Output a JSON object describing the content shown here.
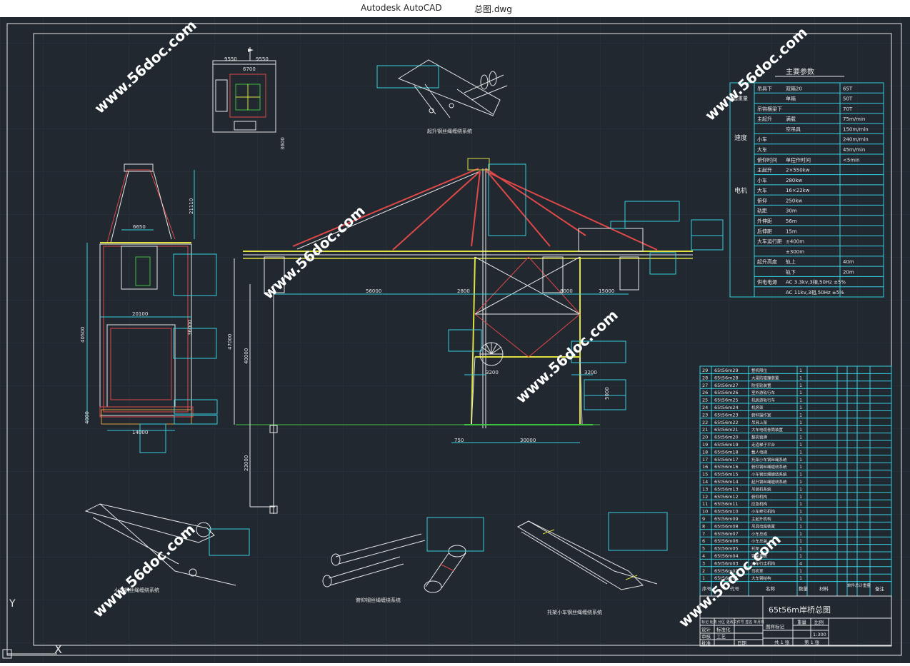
{
  "window": {
    "app_title": "Autodesk AutoCAD",
    "file_name": "总图.dwg"
  },
  "watermark": "www.56doc.com",
  "drawing": {
    "views": {
      "hoist_system": "起升钢丝绳缠绕系统",
      "trolley_system": "小车钢丝绳缠绕系统",
      "boom_system": "俯仰钢丝绳缠绕系统",
      "spreader_trolley_system": "托架小车钢丝绳缠绕系统"
    },
    "dimensions": {
      "top_left": "9550",
      "top_right": "9550",
      "top_mid": "6700",
      "top_side": "3600",
      "front_21110": "21110",
      "front_6650": "6650",
      "front_20100": "20100",
      "front_40500": "40500",
      "front_36000": "36000",
      "front_4000": "4000",
      "front_14000": "14000",
      "side_56000": "56000",
      "side_2800": "2800",
      "side_8000": "8000",
      "side_15000": "15000",
      "side_47000": "47000",
      "side_40000": "40000",
      "side_3200a": "3200",
      "side_3200b": "3200",
      "side_23000": "23000",
      "side_750": "750",
      "side_30000": "30000",
      "side_5000": "5000"
    },
    "params": {
      "title": "主要参数",
      "rows": [
        {
          "a": "吊具下",
          "b": "双箱20",
          "c": "65T"
        },
        {
          "a": "",
          "b": "单箱",
          "c": "50T"
        },
        {
          "a": "吊钩横梁下",
          "b": "",
          "c": "70T"
        },
        {
          "a": "主起升",
          "b": "满载",
          "c": "75m/min"
        },
        {
          "a": "",
          "b": "空吊具",
          "c": "150m/min"
        },
        {
          "a": "小车",
          "b": "",
          "c": "240m/min"
        },
        {
          "a": "大车",
          "b": "",
          "c": "45m/min"
        },
        {
          "a": "俯仰时间",
          "b": "单程作时间",
          "c": "<5min"
        },
        {
          "a": "主起升",
          "b": "2×550kw",
          "c": ""
        },
        {
          "a": "小车",
          "b": "280kw",
          "c": ""
        },
        {
          "a": "大车",
          "b": "16×22kw",
          "c": ""
        },
        {
          "a": "俯仰",
          "b": "250kw",
          "c": ""
        },
        {
          "a": "轨距",
          "b": "30m",
          "c": ""
        },
        {
          "a": "外伸距",
          "b": "56m",
          "c": ""
        },
        {
          "a": "后伸距",
          "b": "15m",
          "c": ""
        },
        {
          "a": "大车运行距",
          "b": "±400m",
          "c": ""
        },
        {
          "a": "",
          "b": "±300m",
          "c": ""
        },
        {
          "a": "起升高度",
          "b": "轨上",
          "c": "40m"
        },
        {
          "a": "",
          "b": "轨下",
          "c": "20m"
        },
        {
          "a": "供电电源",
          "b": "AC 3.3kv,3相,50Hz ±5%",
          "c": ""
        },
        {
          "a": "",
          "b": "AC 11kv,3相,50Hz ±5%",
          "c": ""
        }
      ],
      "speed_label": "速度",
      "motor_label": "电机",
      "hoist_cap_label": "起重量"
    },
    "bom": {
      "rows": [
        {
          "no": "29",
          "code": "65t56m29",
          "name": "整机限位",
          "qty": "1"
        },
        {
          "no": "28",
          "code": "65t56m28",
          "name": "大梁防碰撞装置",
          "qty": "1"
        },
        {
          "no": "27",
          "code": "65t56m27",
          "name": "防扭轮装置",
          "qty": "1"
        },
        {
          "no": "26",
          "code": "65t56m26",
          "name": "室外游轨行车",
          "qty": "1"
        },
        {
          "no": "25",
          "code": "65t56m25",
          "name": "机房游轨行车",
          "qty": "1"
        },
        {
          "no": "24",
          "code": "65t56m24",
          "name": "机房架",
          "qty": "1"
        },
        {
          "no": "23",
          "code": "65t56m23",
          "name": "俯仰操作室",
          "qty": "1"
        },
        {
          "no": "22",
          "code": "65t56m22",
          "name": "吊具上架",
          "qty": "1"
        },
        {
          "no": "21",
          "code": "65t56m21",
          "name": "大车电缆卷筒装置",
          "qty": "1"
        },
        {
          "no": "20",
          "code": "65t56m20",
          "name": "整机锁弹",
          "qty": "1"
        },
        {
          "no": "19",
          "code": "65t56m19",
          "name": "走道梯子平台",
          "qty": "1"
        },
        {
          "no": "18",
          "code": "65t56m18",
          "name": "载人电梯",
          "qty": "1"
        },
        {
          "no": "17",
          "code": "65t56m17",
          "name": "托架小车钢丝绳系统",
          "qty": "1"
        },
        {
          "no": "16",
          "code": "65t56m16",
          "name": "俯仰钢丝绳缠绕系统",
          "qty": "1"
        },
        {
          "no": "15",
          "code": "65t56m15",
          "name": "小车钢丝绳缠绕系统",
          "qty": "1"
        },
        {
          "no": "14",
          "code": "65t56m14",
          "name": "起升钢丝绳缠绕系统",
          "qty": "1"
        },
        {
          "no": "13",
          "code": "65t56m13",
          "name": "吊装机系统",
          "qty": "1"
        },
        {
          "no": "12",
          "code": "65t56m12",
          "name": "俯仰机构",
          "qty": "1"
        },
        {
          "no": "11",
          "code": "65t56m11",
          "name": "应急机构",
          "qty": "1"
        },
        {
          "no": "10",
          "code": "65t56m10",
          "name": "小车牵引机构",
          "qty": "1"
        },
        {
          "no": "9",
          "code": "65t56m09",
          "name": "主起升机构",
          "qty": "1"
        },
        {
          "no": "8",
          "code": "65t56m08",
          "name": "吊具电缆装置",
          "qty": "1"
        },
        {
          "no": "7",
          "code": "65t56m07",
          "name": "小车总成",
          "qty": "1"
        },
        {
          "no": "6",
          "code": "65t56m06",
          "name": "小车总装",
          "qty": "1"
        },
        {
          "no": "5",
          "code": "65t56m05",
          "name": "托架",
          "qty": "1"
        },
        {
          "no": "4",
          "code": "65t56m04",
          "name": "臂架系统",
          "qty": "1"
        },
        {
          "no": "3",
          "code": "65t56m03",
          "name": "大车行走机构",
          "qty": "4"
        },
        {
          "no": "2",
          "code": "65t56m02",
          "name": "司机室",
          "qty": "1"
        },
        {
          "no": "1",
          "code": "65t56m01",
          "name": "大车钢结构",
          "qty": "1"
        }
      ],
      "headers": {
        "no": "序号",
        "code": "代号",
        "name": "名称",
        "qty": "数量",
        "material": "材料",
        "weight": "单件总计重量",
        "remark": "备注"
      }
    },
    "title_block": {
      "drawing_title": "65t56m岸桥总图",
      "scale_label": "比例",
      "scale": "1:300",
      "stage_label": "图样标记",
      "weight_label": "重量",
      "sheet_count": "共 1 张",
      "sheet_no": "第 1 张",
      "rev_label": "标记 处数 分区 更改文件号 签名 年月日",
      "design": "设计",
      "standard": "标准化",
      "review": "审核",
      "process": "工艺",
      "approve": "批准",
      "date": "日期"
    },
    "ucs": {
      "y": "Y",
      "x": "X"
    }
  }
}
